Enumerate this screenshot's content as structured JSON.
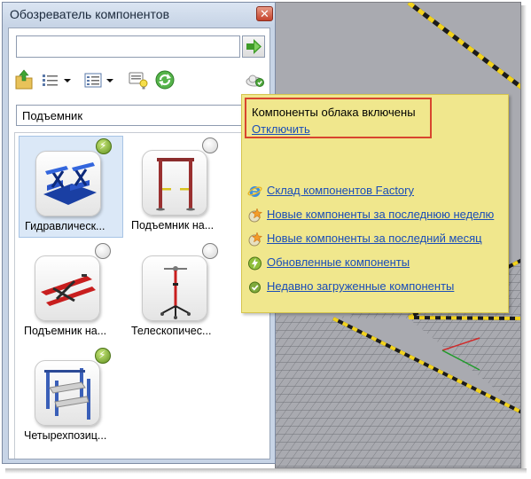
{
  "window": {
    "title": "Обозреватель компонентов",
    "close_glyph": "✕"
  },
  "search": {
    "value": "",
    "placeholder": "",
    "go_icon": "green-arrow-right-icon"
  },
  "toolbar": {
    "icons": [
      "folder-up-icon",
      "list-view-icon",
      "dropdown-arrow-icon",
      "details-view-icon",
      "dropdown-arrow-icon",
      "tip-lightbulb-icon",
      "refresh-icon",
      "cloud-icon"
    ]
  },
  "category": {
    "value": "Подъемник"
  },
  "components": [
    {
      "label": "Гидравлическ...",
      "status": "updated",
      "selected": true
    },
    {
      "label": "Подъемник на...",
      "status": "not-downloaded",
      "selected": false
    },
    {
      "label": "Подъемник на...",
      "status": "not-downloaded",
      "selected": false
    },
    {
      "label": "Телескопичес...",
      "status": "not-downloaded",
      "selected": false
    },
    {
      "label": "Четырехпозиц...",
      "status": "updated",
      "selected": false
    }
  ],
  "cloud_popup": {
    "status_text": "Компоненты облака включены",
    "disable_link": "Отключить",
    "links": [
      {
        "label": "Склад компонентов Factory",
        "icon": "internet-explorer-icon"
      },
      {
        "label": "Новые компоненты за последнюю неделю",
        "icon": "new-component-star-icon"
      },
      {
        "label": "Новые компоненты за последний месяц",
        "icon": "new-component-star-icon"
      },
      {
        "label": "Обновленные компоненты",
        "icon": "updated-bolt-icon"
      },
      {
        "label": "Недавно загруженные компоненты",
        "icon": "downloaded-check-icon"
      }
    ]
  },
  "colors": {
    "popup_background": "#f0e78d",
    "popup_highlight_border": "#d8452e",
    "link": "#1a4db8",
    "panel_frame": "#c7d4e6",
    "viewport": "#a9aab0",
    "hazard_stripe": "#f2d21d"
  }
}
